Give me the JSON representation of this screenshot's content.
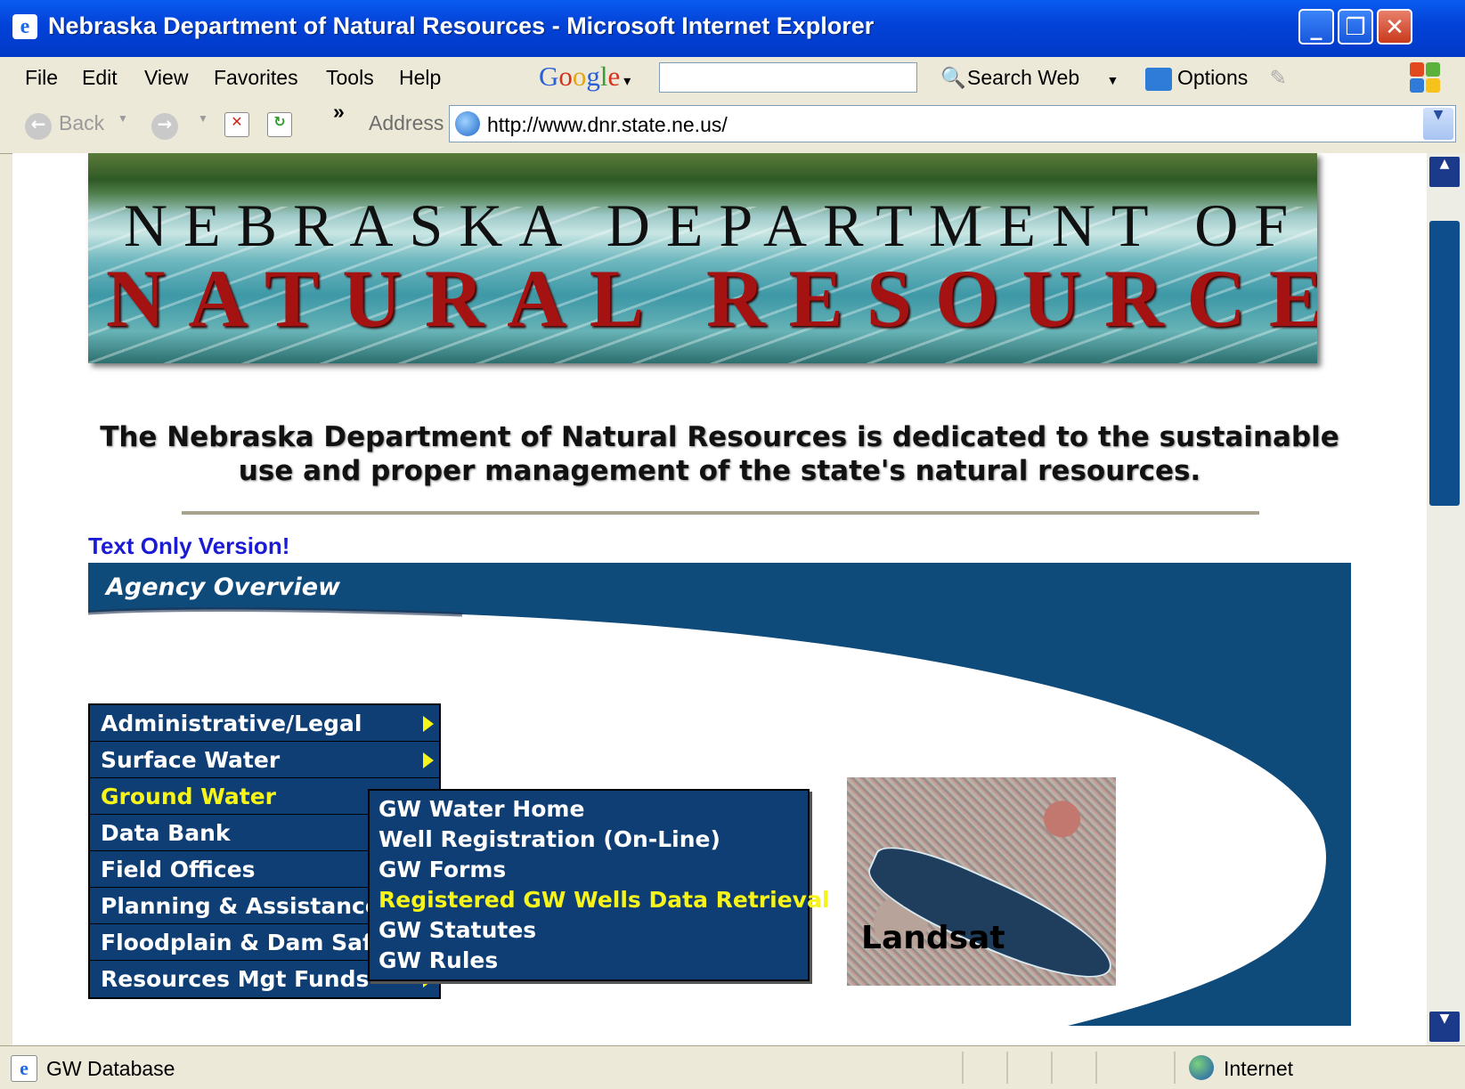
{
  "window": {
    "title": "Nebraska Department of Natural Resources - Microsoft Internet Explorer",
    "controls": [
      "_",
      "❐",
      "✕"
    ]
  },
  "menubar": {
    "items": [
      "File",
      "Edit",
      "View",
      "Favorites",
      "Tools",
      "Help"
    ],
    "google_label": "Google",
    "google_search_value": "",
    "search_web_label": "Search Web",
    "options_label": "Options"
  },
  "toolbar": {
    "back_label": "Back",
    "address_label": "Address",
    "address_url": "http://www.dnr.state.ne.us/"
  },
  "page": {
    "banner_line1": "NEBRASKA DEPARTMENT OF",
    "banner_line2": "NATURAL RESOURCES",
    "mission_line1": "The Nebraska Department of Natural Resources is dedicated to the sustainable",
    "mission_line2": "use and proper management of the state's natural resources.",
    "text_only_link": "Text Only Version!",
    "overview_title": "Agency Overview",
    "menu": [
      {
        "label": "Administrative/Legal",
        "has_submenu": true
      },
      {
        "label": "Surface Water",
        "has_submenu": true
      },
      {
        "label": "Ground Water",
        "active": true
      },
      {
        "label": "Data Bank"
      },
      {
        "label": "Field Offices"
      },
      {
        "label": "Planning & Assistance"
      },
      {
        "label": "Floodplain & Dam Safety"
      },
      {
        "label": "Resources Mgt Funds",
        "has_submenu": true
      }
    ],
    "submenu": [
      {
        "label": "GW Water Home"
      },
      {
        "label": "Well Registration (On-Line)"
      },
      {
        "label": "GW Forms"
      },
      {
        "label": "Registered GW Wells Data Retrieval",
        "highlighted": true
      },
      {
        "label": "GW Statutes"
      },
      {
        "label": "GW Rules"
      }
    ],
    "landsat_label": "Landsat"
  },
  "statusbar": {
    "text": "GW Database",
    "zone": "Internet"
  },
  "colors": {
    "menu_bg": "#0e3e73",
    "menu_highlight": "#f7f41b",
    "link": "#1b1bd6",
    "titlebar": "#0343d9"
  }
}
